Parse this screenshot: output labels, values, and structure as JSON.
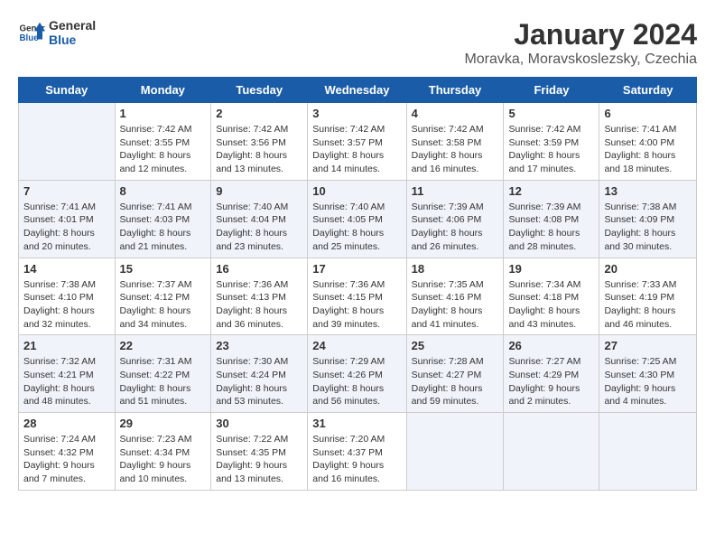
{
  "header": {
    "logo_line1": "General",
    "logo_line2": "Blue",
    "month": "January 2024",
    "location": "Moravka, Moravskoslezsky, Czechia"
  },
  "weekdays": [
    "Sunday",
    "Monday",
    "Tuesday",
    "Wednesday",
    "Thursday",
    "Friday",
    "Saturday"
  ],
  "weeks": [
    [
      {
        "day": "",
        "info": ""
      },
      {
        "day": "1",
        "info": "Sunrise: 7:42 AM\nSunset: 3:55 PM\nDaylight: 8 hours\nand 12 minutes."
      },
      {
        "day": "2",
        "info": "Sunrise: 7:42 AM\nSunset: 3:56 PM\nDaylight: 8 hours\nand 13 minutes."
      },
      {
        "day": "3",
        "info": "Sunrise: 7:42 AM\nSunset: 3:57 PM\nDaylight: 8 hours\nand 14 minutes."
      },
      {
        "day": "4",
        "info": "Sunrise: 7:42 AM\nSunset: 3:58 PM\nDaylight: 8 hours\nand 16 minutes."
      },
      {
        "day": "5",
        "info": "Sunrise: 7:42 AM\nSunset: 3:59 PM\nDaylight: 8 hours\nand 17 minutes."
      },
      {
        "day": "6",
        "info": "Sunrise: 7:41 AM\nSunset: 4:00 PM\nDaylight: 8 hours\nand 18 minutes."
      }
    ],
    [
      {
        "day": "7",
        "info": "Sunrise: 7:41 AM\nSunset: 4:01 PM\nDaylight: 8 hours\nand 20 minutes."
      },
      {
        "day": "8",
        "info": "Sunrise: 7:41 AM\nSunset: 4:03 PM\nDaylight: 8 hours\nand 21 minutes."
      },
      {
        "day": "9",
        "info": "Sunrise: 7:40 AM\nSunset: 4:04 PM\nDaylight: 8 hours\nand 23 minutes."
      },
      {
        "day": "10",
        "info": "Sunrise: 7:40 AM\nSunset: 4:05 PM\nDaylight: 8 hours\nand 25 minutes."
      },
      {
        "day": "11",
        "info": "Sunrise: 7:39 AM\nSunset: 4:06 PM\nDaylight: 8 hours\nand 26 minutes."
      },
      {
        "day": "12",
        "info": "Sunrise: 7:39 AM\nSunset: 4:08 PM\nDaylight: 8 hours\nand 28 minutes."
      },
      {
        "day": "13",
        "info": "Sunrise: 7:38 AM\nSunset: 4:09 PM\nDaylight: 8 hours\nand 30 minutes."
      }
    ],
    [
      {
        "day": "14",
        "info": "Sunrise: 7:38 AM\nSunset: 4:10 PM\nDaylight: 8 hours\nand 32 minutes."
      },
      {
        "day": "15",
        "info": "Sunrise: 7:37 AM\nSunset: 4:12 PM\nDaylight: 8 hours\nand 34 minutes."
      },
      {
        "day": "16",
        "info": "Sunrise: 7:36 AM\nSunset: 4:13 PM\nDaylight: 8 hours\nand 36 minutes."
      },
      {
        "day": "17",
        "info": "Sunrise: 7:36 AM\nSunset: 4:15 PM\nDaylight: 8 hours\nand 39 minutes."
      },
      {
        "day": "18",
        "info": "Sunrise: 7:35 AM\nSunset: 4:16 PM\nDaylight: 8 hours\nand 41 minutes."
      },
      {
        "day": "19",
        "info": "Sunrise: 7:34 AM\nSunset: 4:18 PM\nDaylight: 8 hours\nand 43 minutes."
      },
      {
        "day": "20",
        "info": "Sunrise: 7:33 AM\nSunset: 4:19 PM\nDaylight: 8 hours\nand 46 minutes."
      }
    ],
    [
      {
        "day": "21",
        "info": "Sunrise: 7:32 AM\nSunset: 4:21 PM\nDaylight: 8 hours\nand 48 minutes."
      },
      {
        "day": "22",
        "info": "Sunrise: 7:31 AM\nSunset: 4:22 PM\nDaylight: 8 hours\nand 51 minutes."
      },
      {
        "day": "23",
        "info": "Sunrise: 7:30 AM\nSunset: 4:24 PM\nDaylight: 8 hours\nand 53 minutes."
      },
      {
        "day": "24",
        "info": "Sunrise: 7:29 AM\nSunset: 4:26 PM\nDaylight: 8 hours\nand 56 minutes."
      },
      {
        "day": "25",
        "info": "Sunrise: 7:28 AM\nSunset: 4:27 PM\nDaylight: 8 hours\nand 59 minutes."
      },
      {
        "day": "26",
        "info": "Sunrise: 7:27 AM\nSunset: 4:29 PM\nDaylight: 9 hours\nand 2 minutes."
      },
      {
        "day": "27",
        "info": "Sunrise: 7:25 AM\nSunset: 4:30 PM\nDaylight: 9 hours\nand 4 minutes."
      }
    ],
    [
      {
        "day": "28",
        "info": "Sunrise: 7:24 AM\nSunset: 4:32 PM\nDaylight: 9 hours\nand 7 minutes."
      },
      {
        "day": "29",
        "info": "Sunrise: 7:23 AM\nSunset: 4:34 PM\nDaylight: 9 hours\nand 10 minutes."
      },
      {
        "day": "30",
        "info": "Sunrise: 7:22 AM\nSunset: 4:35 PM\nDaylight: 9 hours\nand 13 minutes."
      },
      {
        "day": "31",
        "info": "Sunrise: 7:20 AM\nSunset: 4:37 PM\nDaylight: 9 hours\nand 16 minutes."
      },
      {
        "day": "",
        "info": ""
      },
      {
        "day": "",
        "info": ""
      },
      {
        "day": "",
        "info": ""
      }
    ]
  ]
}
